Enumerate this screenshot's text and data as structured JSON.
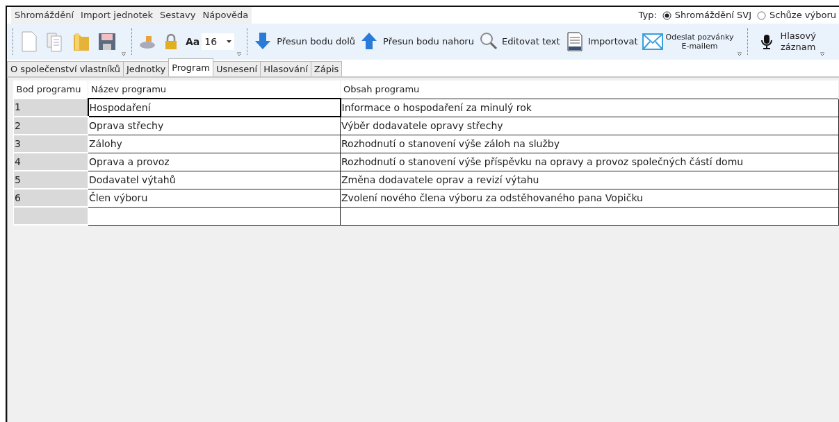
{
  "menu": [
    "Shromáždění",
    "Import jednotek",
    "Sestavy",
    "Nápověda"
  ],
  "type_selector": {
    "label": "Typ:",
    "options": [
      {
        "label": "Shromáždění SVJ",
        "selected": true
      },
      {
        "label": "Schůze výboru",
        "selected": false
      }
    ]
  },
  "toolbar": {
    "font": {
      "label": "Aa",
      "value": "16"
    },
    "buttons": [
      {
        "label": "Přesun bodu dolů"
      },
      {
        "label": "Přesun bodu nahoru"
      },
      {
        "label": "Editovat text"
      },
      {
        "label": "Importovat"
      },
      {
        "label": "Odeslat pozvánky\nE-mailem"
      }
    ],
    "voice": {
      "label": "Hlasový\nzáznam"
    }
  },
  "tabs": [
    {
      "label": "O společenství vlastníků",
      "selected": false
    },
    {
      "label": "Jednotky",
      "selected": false
    },
    {
      "label": "Program",
      "selected": true
    },
    {
      "label": "Usnesení",
      "selected": false
    },
    {
      "label": "Hlasování",
      "selected": false
    },
    {
      "label": "Zápis",
      "selected": false
    }
  ],
  "table": {
    "columns": [
      "Bod programu",
      "Název programu",
      "Obsah programu"
    ],
    "rows": [
      {
        "number": "1",
        "name": "Hospodaření",
        "content": "Informace o hospodaření za minulý rok",
        "focused": true
      },
      {
        "number": "2",
        "name": "Oprava střechy",
        "content": "Výběr dodavatele opravy střechy",
        "focused": false
      },
      {
        "number": "3",
        "name": "Zálohy",
        "content": "Rozhodnutí o stanovení výše záloh na služby",
        "focused": false
      },
      {
        "number": "4",
        "name": "Oprava a provoz",
        "content": "Rozhodnutí o stanovení výše příspěvku na opravy a provoz společných částí domu",
        "focused": false
      },
      {
        "number": "5",
        "name": "Dodavatel výtahů",
        "content": "Změna dodavatele oprav a revizí výtahu",
        "focused": false
      },
      {
        "number": "6",
        "name": "Člen výboru",
        "content": "Zvolení nového člena výboru za odstěhovaného pana Vopičku",
        "focused": false
      }
    ]
  }
}
